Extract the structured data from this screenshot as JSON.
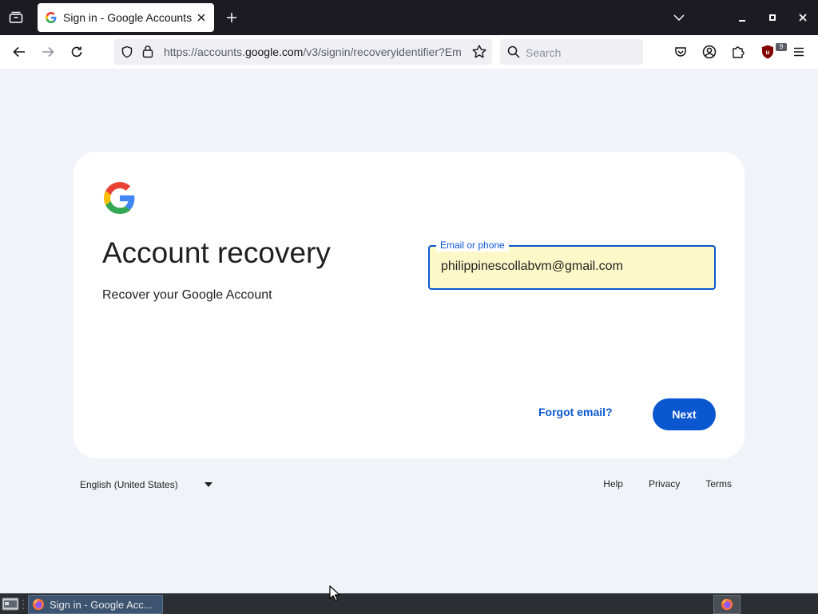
{
  "browser": {
    "tab": {
      "title": "Sign in - Google Accounts"
    },
    "url": {
      "prefix": "https://accounts.",
      "domain": "google.com",
      "path": "/v3/signin/recoveryidentifier?Em"
    },
    "search": {
      "placeholder": "Search"
    },
    "extension_badge": "9"
  },
  "page": {
    "heading": "Account recovery",
    "subheading": "Recover your Google Account",
    "email_field": {
      "label": "Email or phone",
      "value": "philippinescollabvm@gmail.com"
    },
    "forgot_email": "Forgot email?",
    "next_button": "Next"
  },
  "footer": {
    "language": "English (United States)",
    "links": {
      "help": "Help",
      "privacy": "Privacy",
      "terms": "Terms"
    }
  },
  "taskbar": {
    "task_label": "Sign in - Google Acc..."
  },
  "colors": {
    "accent": "#0b57d0",
    "page_background": "#f0f4f9",
    "autofill_background": "#fdf8c8",
    "chrome_dark": "#1c1b22"
  }
}
